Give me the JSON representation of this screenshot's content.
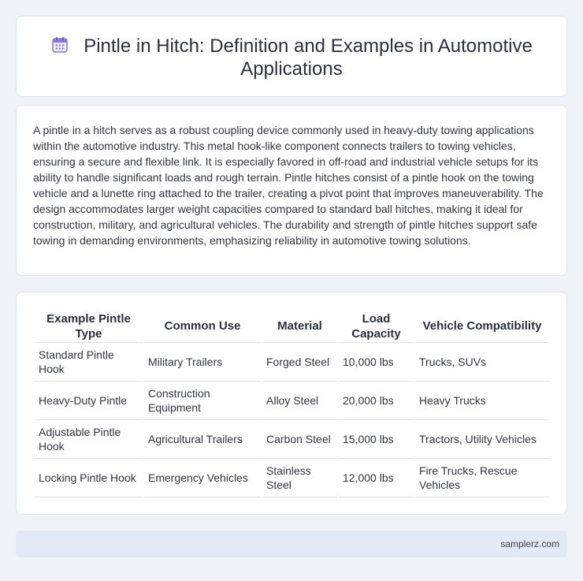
{
  "header": {
    "icon": "calendar-icon",
    "title": "Pintle in Hitch: Definition and Examples in Automotive Applications"
  },
  "description": "A pintle in a hitch serves as a robust coupling device commonly used in heavy-duty towing applications within the automotive industry. This metal hook-like component connects trailers to towing vehicles, ensuring a secure and flexible link. It is especially favored in off-road and industrial vehicle setups for its ability to handle significant loads and rough terrain. Pintle hitches consist of a pintle hook on the towing vehicle and a lunette ring attached to the trailer, creating a pivot point that improves maneuverability. The design accommodates larger weight capacities compared to standard ball hitches, making it ideal for construction, military, and agricultural vehicles. The durability and strength of pintle hitches support safe towing in demanding environments, emphasizing reliability in automotive towing solutions.",
  "table": {
    "headers": [
      "Example Pintle Type",
      "Common Use",
      "Material",
      "Load Capacity",
      "Vehicle Compatibility"
    ],
    "rows": [
      [
        "Standard Pintle Hook",
        "Military Trailers",
        "Forged Steel",
        "10,000 lbs",
        "Trucks, SUVs"
      ],
      [
        "Heavy-Duty Pintle",
        "Construction Equipment",
        "Alloy Steel",
        "20,000 lbs",
        "Heavy Trucks"
      ],
      [
        "Adjustable Pintle Hook",
        "Agricultural Trailers",
        "Carbon Steel",
        "15,000 lbs",
        "Tractors, Utility Vehicles"
      ],
      [
        "Locking Pintle Hook",
        "Emergency Vehicles",
        "Stainless Steel",
        "12,000 lbs",
        "Fire Trucks, Rescue Vehicles"
      ]
    ]
  },
  "footer": {
    "site": "samplerz.com"
  },
  "colors": {
    "page_background": "#eff3f8",
    "card_background": "#ffffff",
    "footer_background": "#e4eaf5",
    "icon_purple": "#8a78d6"
  }
}
